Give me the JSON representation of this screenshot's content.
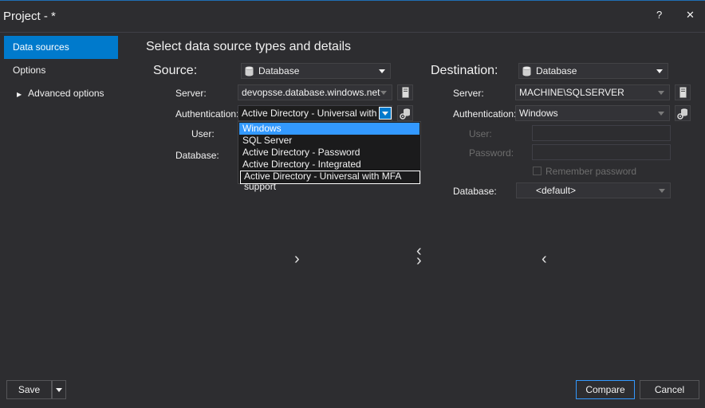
{
  "window": {
    "title": "Project - *",
    "help_label": "?",
    "close_label": "✕"
  },
  "nav": {
    "items": [
      {
        "label": "Data sources",
        "active": true
      },
      {
        "label": "Options",
        "active": false
      },
      {
        "label": "Advanced options",
        "active": false
      }
    ],
    "expand_glyph": "▶"
  },
  "heading": "Select data source types and details",
  "source": {
    "title": "Source:",
    "type": "Database",
    "server_label": "Server:",
    "server_value": "devopsse.database.windows.net",
    "auth_label": "Authentication:",
    "auth_value": "Active Directory - Universal with ...",
    "user_label": "User:",
    "database_label": "Database:",
    "auth_options": [
      "Windows",
      "SQL Server",
      "Active Directory - Password",
      "Active Directory - Integrated",
      "Active Directory - Universal with MFA support"
    ]
  },
  "destination": {
    "title": "Destination:",
    "type": "Database",
    "server_label": "Server:",
    "server_value": "MACHINE\\SQLSERVER",
    "auth_label": "Authentication:",
    "auth_value": "Windows",
    "user_label": "User:",
    "password_label": "Password:",
    "remember_label": "Remember password",
    "database_label": "Database:",
    "database_value": "<default>"
  },
  "arrows": {
    "right": "›",
    "swap_top": "‹",
    "swap_bottom": "›",
    "left": "‹"
  },
  "footer": {
    "save_label": "Save",
    "compare_label": "Compare",
    "cancel_label": "Cancel"
  },
  "colors": {
    "accent": "#007acc",
    "background": "#2d2d30",
    "selection": "#3399ff"
  }
}
